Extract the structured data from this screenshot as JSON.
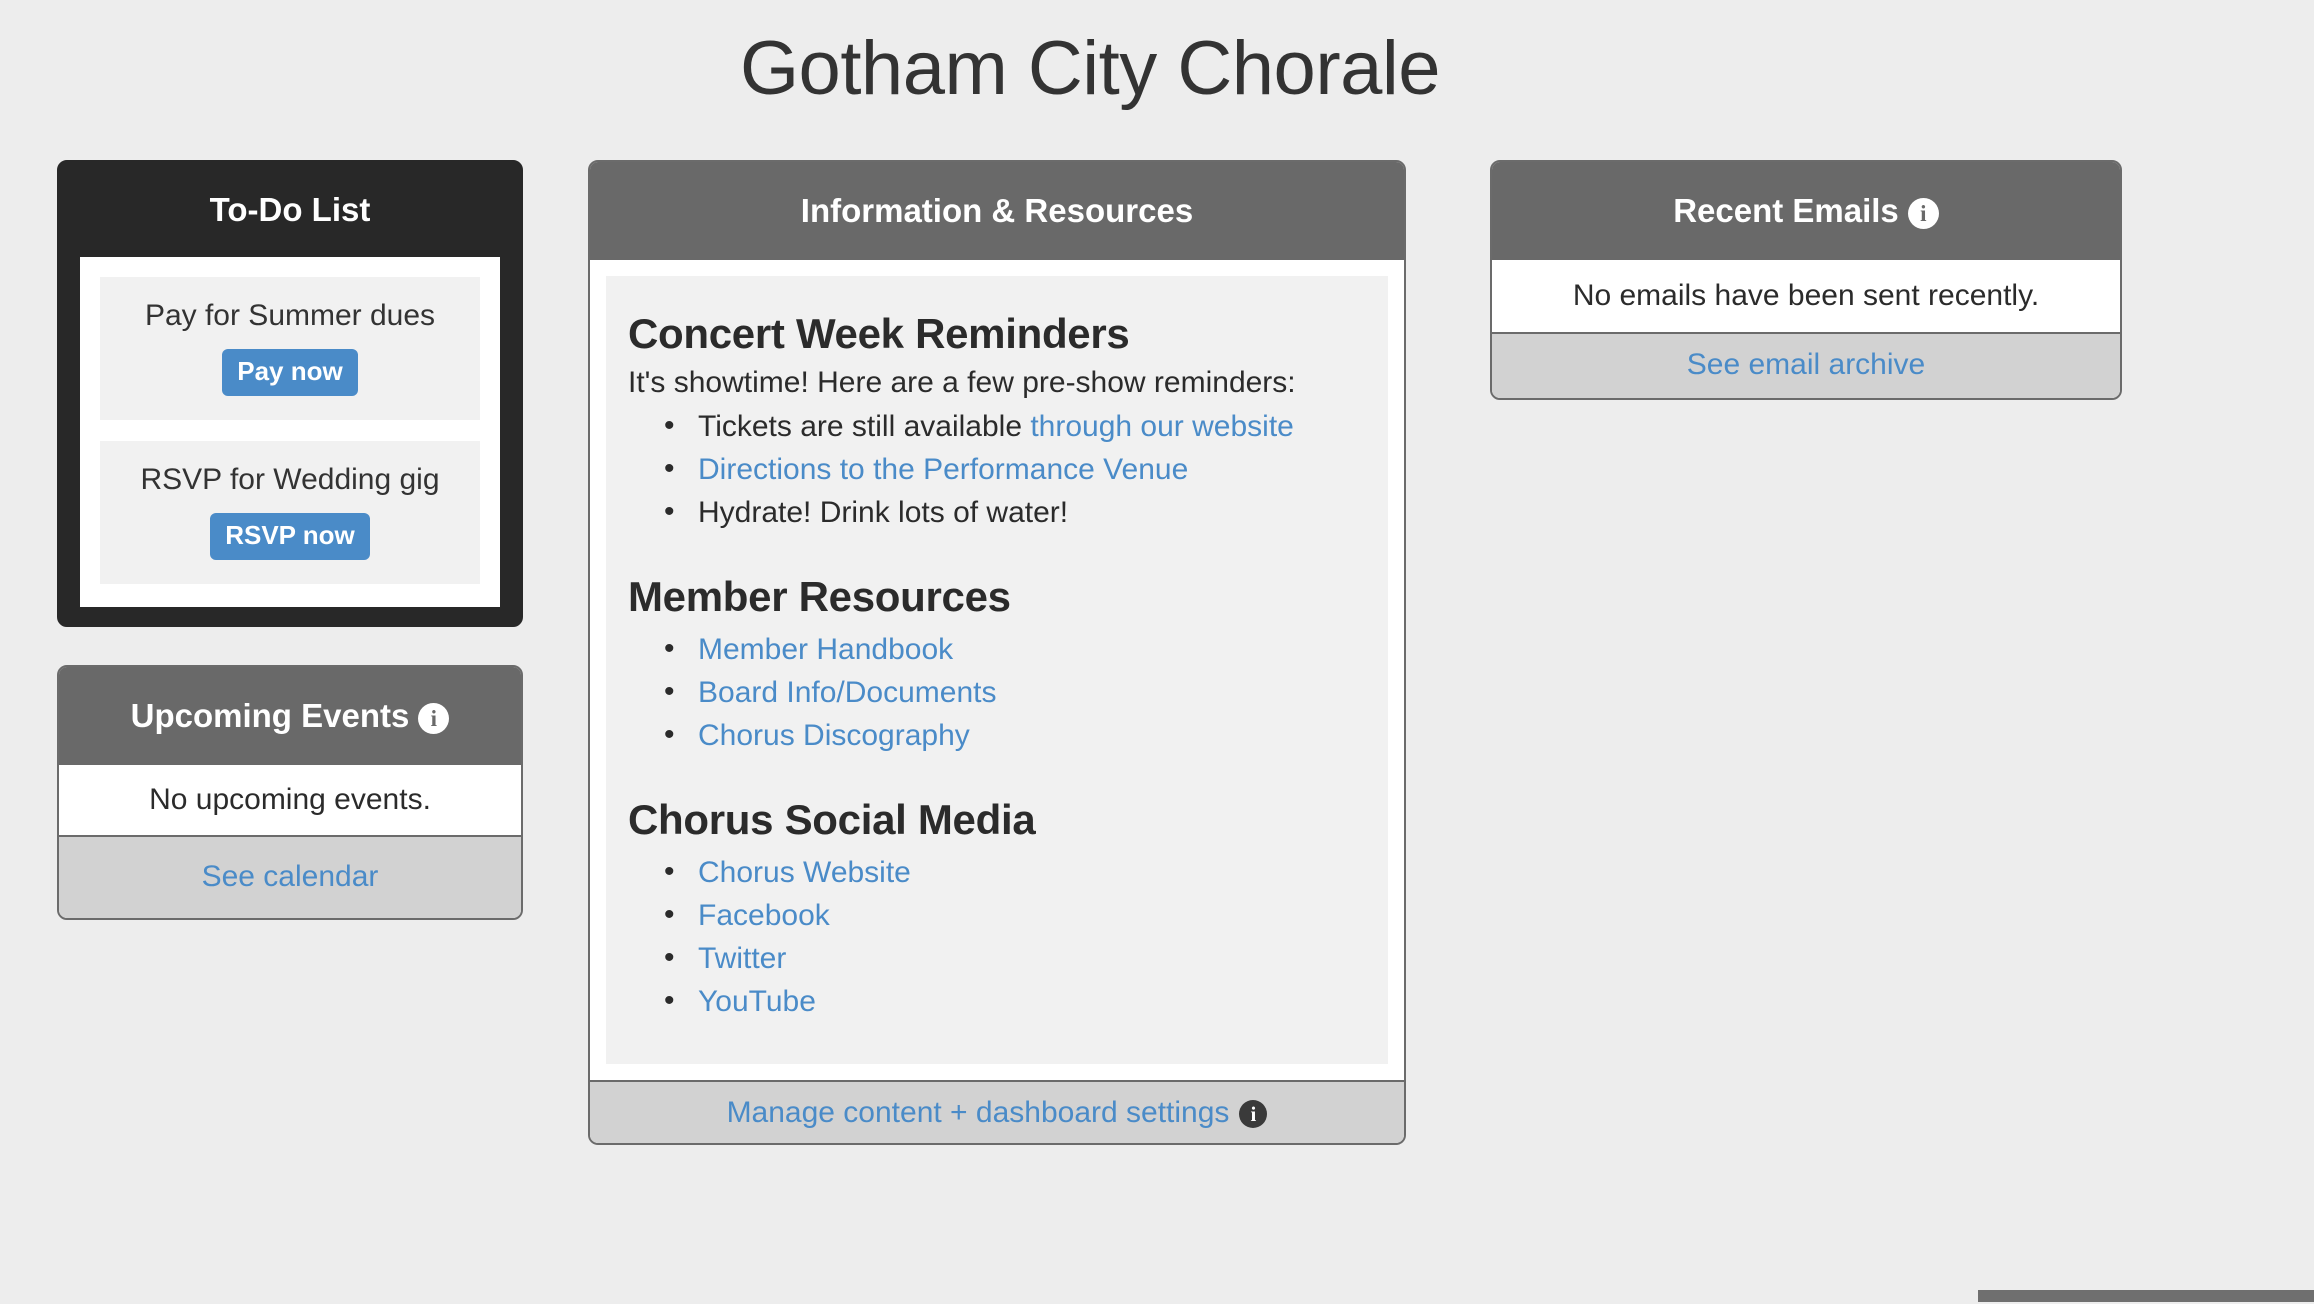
{
  "header": {
    "title": "Gotham City Chorale"
  },
  "todo": {
    "title": "To-Do List",
    "items": [
      {
        "label": "Pay for Summer dues",
        "button": "Pay now"
      },
      {
        "label": "RSVP for Wedding gig",
        "button": "RSVP now"
      }
    ]
  },
  "events": {
    "title": "Upcoming Events",
    "info_icon": "info-icon",
    "empty_message": "No upcoming events.",
    "footer_link": "See calendar"
  },
  "info_resources": {
    "title": "Information & Resources",
    "sections": [
      {
        "heading": "Concert Week Reminders",
        "intro": "It's showtime! Here are a few pre-show reminders:",
        "bullets": [
          {
            "prefix": "Tickets are still available ",
            "link": "through our website"
          },
          {
            "prefix": "",
            "link": "Directions to the Performance Venue"
          },
          {
            "prefix": "Hydrate! Drink lots of water!",
            "link": ""
          }
        ]
      },
      {
        "heading": "Member Resources",
        "intro": "",
        "bullets": [
          {
            "prefix": "",
            "link": "Member Handbook"
          },
          {
            "prefix": "",
            "link": "Board Info/Documents"
          },
          {
            "prefix": "",
            "link": "Chorus Discography"
          }
        ]
      },
      {
        "heading": "Chorus Social Media",
        "intro": "",
        "bullets": [
          {
            "prefix": "",
            "link": "Chorus Website"
          },
          {
            "prefix": "",
            "link": "Facebook"
          },
          {
            "prefix": "",
            "link": "Twitter"
          },
          {
            "prefix": "",
            "link": "YouTube"
          }
        ]
      }
    ],
    "footer_link": "Manage content + dashboard settings",
    "footer_info_icon": "info-icon"
  },
  "emails": {
    "title": "Recent Emails",
    "info_icon": "info-icon",
    "empty_message": "No emails have been sent recently.",
    "footer_link": "See email archive"
  },
  "colors": {
    "page_background": "#ededed",
    "header_gray": "#696969",
    "todo_dark": "#282828",
    "link_blue": "#4a8bc8",
    "button_blue": "#4a8bc8",
    "footer_gray": "#d2d2d2",
    "content_gray": "#f1f1f1",
    "text_dark": "#2b2b2b"
  },
  "icon_glyph": "i"
}
